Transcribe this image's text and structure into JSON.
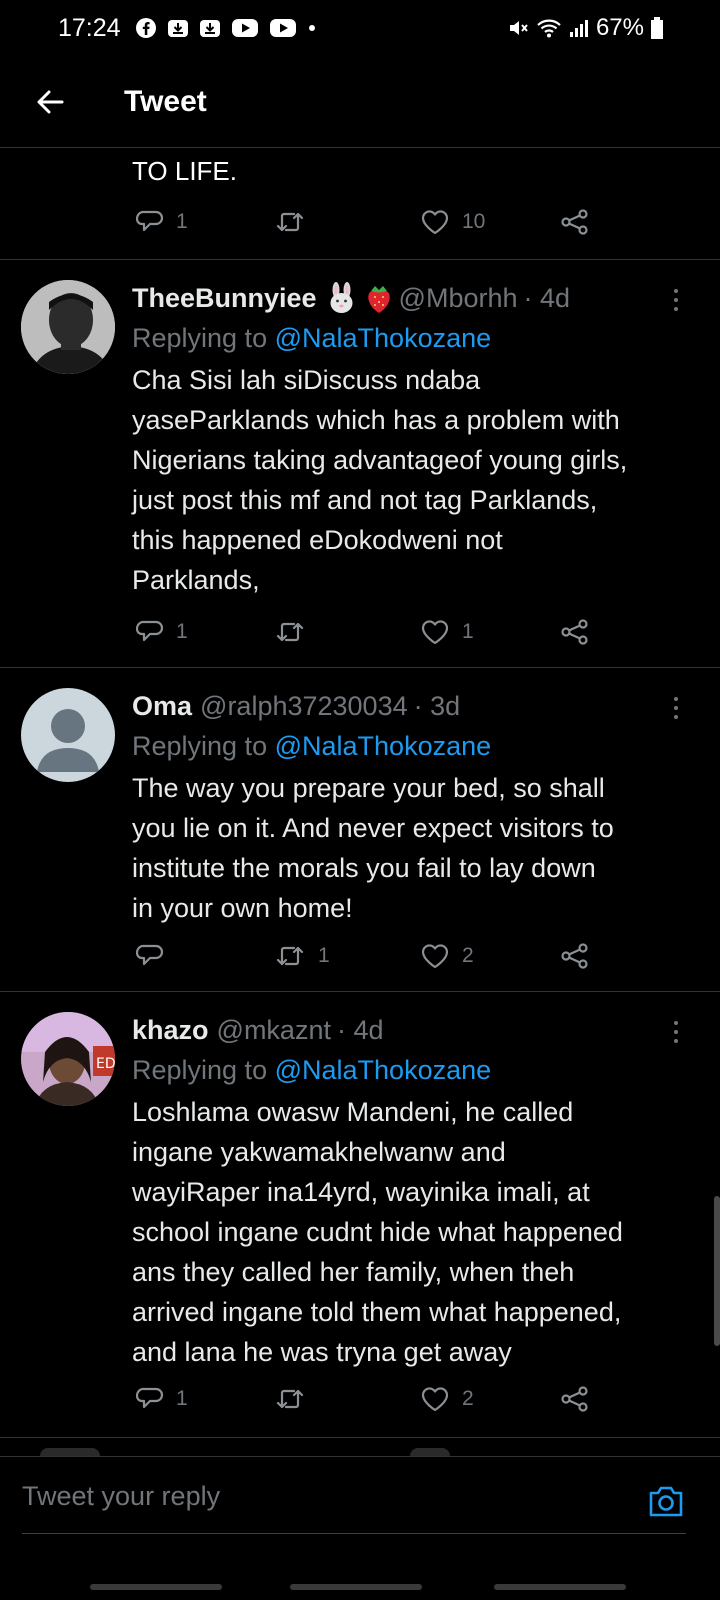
{
  "status_bar": {
    "time": "17:24",
    "battery": "67%",
    "left_icons": [
      "facebook-icon",
      "download-icon",
      "download-icon",
      "youtube-icon",
      "youtube-icon",
      "dot-icon"
    ],
    "right_icons": [
      "mute-icon",
      "wifi-icon",
      "signal-icon",
      "battery-icon"
    ]
  },
  "header": {
    "title": "Tweet"
  },
  "previous_tweet": {
    "text": "TO LIFE.",
    "reply_count": "1",
    "retweet_count": "",
    "like_count": "10"
  },
  "tweets": [
    {
      "name": "TheeBunnyiee",
      "emojis": [
        "rabbit-emoji",
        "strawberry-emoji"
      ],
      "handle": "@Mborhh",
      "time": "· 4d",
      "replying_label": "Replying to",
      "replying_to": "@NalaThokozane",
      "lines": [
        "Cha Sisi lah siDiscuss ndaba",
        "yaseParklands which has a problem with",
        "Nigerians taking advantageof young girls,",
        "just post this mf and not tag Parklands,",
        "this happened eDokodweni not",
        "Parklands,"
      ],
      "reply_count": "1",
      "retweet_count": "",
      "like_count": "1"
    },
    {
      "name": "Oma",
      "emojis": [],
      "handle": "@ralph37230034",
      "time": "· 3d",
      "replying_label": "Replying to",
      "replying_to": "@NalaThokozane",
      "lines": [
        "The way you prepare your bed, so shall",
        "you lie on it. And never expect visitors to",
        "institute the morals you fail to lay down",
        "in your own home!"
      ],
      "reply_count": "",
      "retweet_count": "1",
      "like_count": "2"
    },
    {
      "name": "khazo",
      "emojis": [],
      "handle": "@mkaznt",
      "time": "· 4d",
      "replying_label": "Replying to",
      "replying_to": "@NalaThokozane",
      "lines": [
        "Loshlama owasw Mandeni, he called",
        "ingane yakwamakhelwanw and",
        "wayiRaper ina14yrd, wayinika imali, at",
        "school ingane cudnt hide what happened",
        "ans they called her family, when theh",
        "arrived ingane told them what happened,",
        "and lana he was tryna get away"
      ],
      "reply_count": "1",
      "retweet_count": "",
      "like_count": "2"
    }
  ],
  "reply_box": {
    "placeholder": "Tweet your reply"
  },
  "colors": {
    "link": "#1d9bf0",
    "muted": "#71767b",
    "divider": "#2f3336",
    "background": "#000000"
  }
}
